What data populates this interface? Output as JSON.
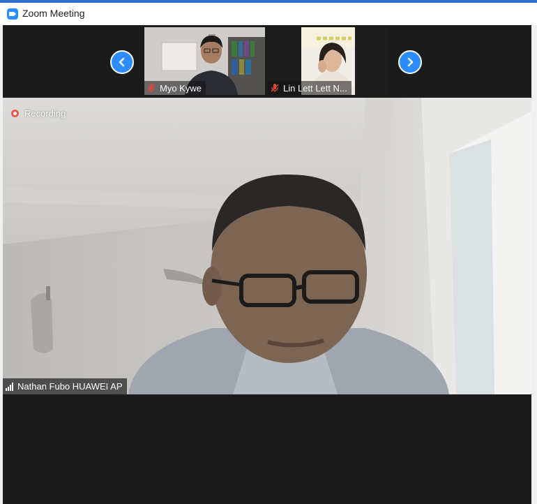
{
  "window": {
    "title": "Zoom Meeting",
    "app_icon": "zoom-camera-icon"
  },
  "gallery": {
    "prev_icon": "chevron-left-icon",
    "next_icon": "chevron-right-icon",
    "participants": [
      {
        "name": "Myo Kywe",
        "mic": "muted"
      },
      {
        "name": "Lin Lett Lett N...",
        "mic": "muted"
      }
    ]
  },
  "main_video": {
    "recording_label": "Recording",
    "speaker_name": "Nathan Fubo HUAWEI AP",
    "signal_icon": "signal-bars-icon"
  },
  "colors": {
    "accent": "#2d8cff",
    "recording": "#e55b4f",
    "muted_mic": "#e0463a",
    "meeting_background": "#1c1b1b"
  }
}
